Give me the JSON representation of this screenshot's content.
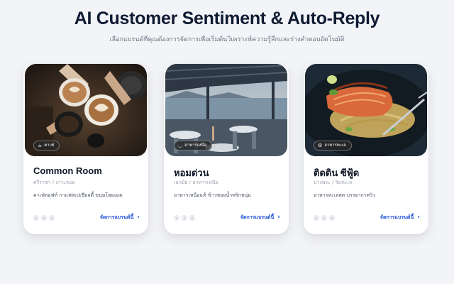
{
  "header": {
    "title": "AI Customer Sentiment & Auto-Reply",
    "subtitle": "เลือกแบรนด์ที่คุณต้องการจัดการเพื่อเริ่มต้นวิเคราะห์ความรู้สึกและร่างคำตอบอัตโนมัติ"
  },
  "cards": [
    {
      "badge": "คาเฟ่",
      "badge_icon": "coffee-cup-icon",
      "name": "Common Room",
      "location": "ศรีราชา / เกาะลอย",
      "description": "คาเฟ่ลอฟท์ กาแฟสเปเชียลตี้ ขนมโฮมเมด",
      "action": "จัดการแบรนด์นี้",
      "image": "coffee-cups-photo"
    },
    {
      "badge": "อาหารเหนือ",
      "badge_icon": "bowl-icon",
      "name": "หอมด่วน",
      "location": "เอกมัย / อาหารเหนือ",
      "description": "อาหารเหนือแท้ ข้าวซอยน้ำพริกหนุ่ม",
      "action": "จัดการแบรนด์นี้",
      "image": "seaside-terrace-restaurant-photo"
    },
    {
      "badge": "อาหารทะเล",
      "badge_icon": "fish-icon",
      "name": "ติดดิน ซีฟู้ด",
      "location": "บางพระ / ริมทะเล",
      "description": "อาหารทะเลสด บรรยากาศวิว",
      "action": "จัดการแบรนด์นี้",
      "image": "salmon-dish-photo"
    }
  ]
}
